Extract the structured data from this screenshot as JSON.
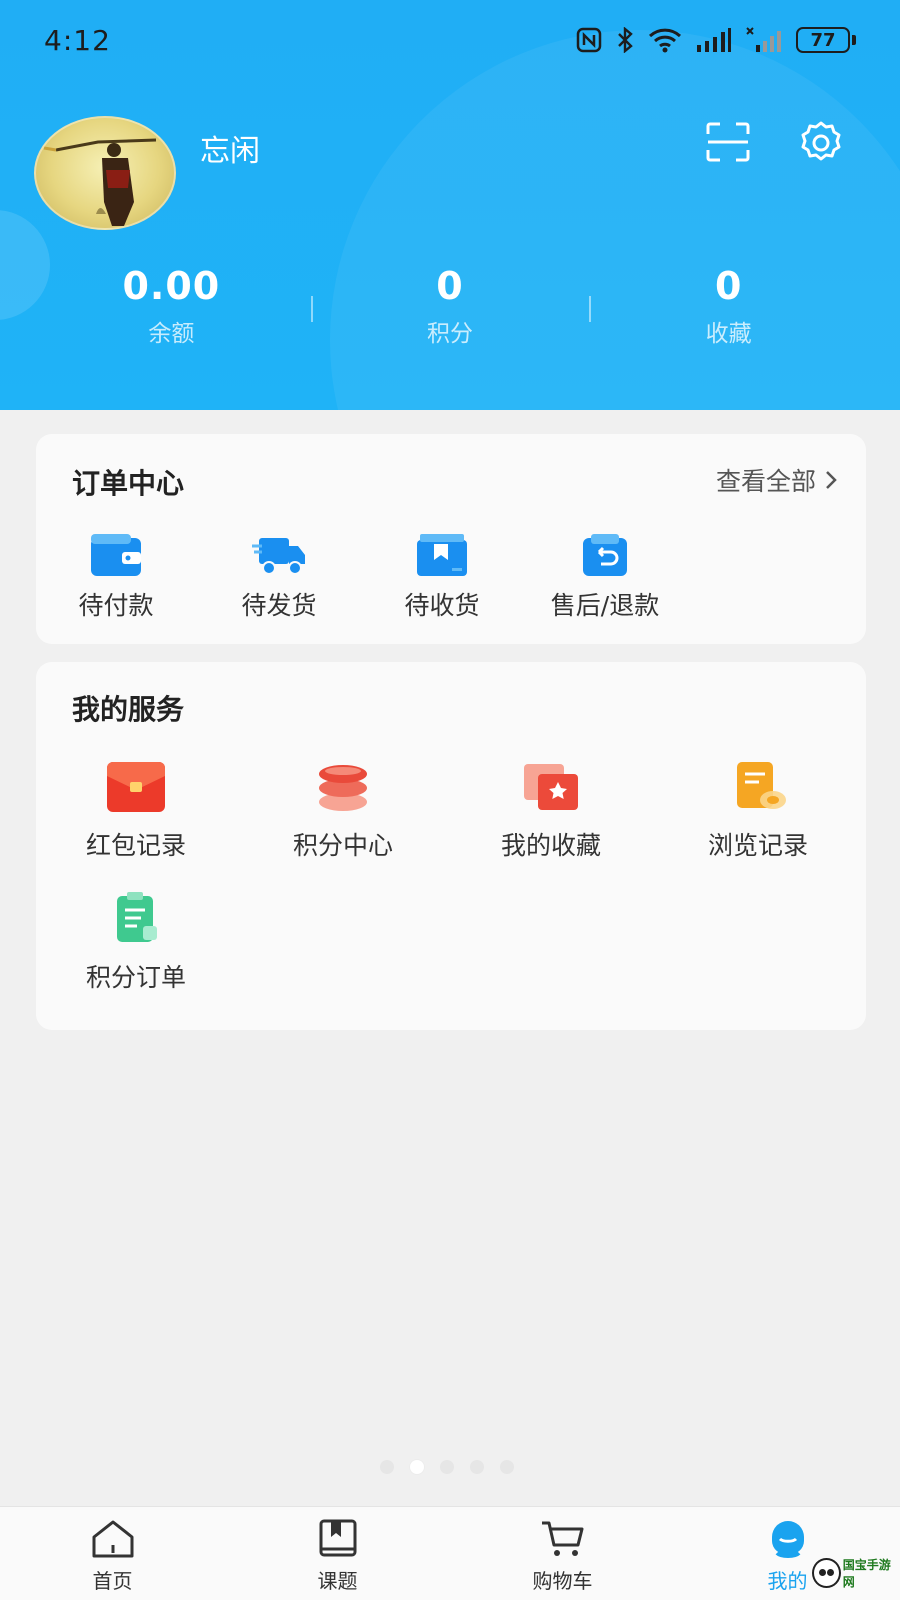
{
  "status_bar": {
    "time": "4:12",
    "battery": "77"
  },
  "profile": {
    "username": "忘闲"
  },
  "stats": [
    {
      "value": "0.00",
      "label": "余额"
    },
    {
      "value": "0",
      "label": "积分"
    },
    {
      "value": "0",
      "label": "收藏"
    }
  ],
  "orders": {
    "title": "订单中心",
    "view_all": "查看全部",
    "items": [
      {
        "label": "待付款",
        "icon": "wallet-icon"
      },
      {
        "label": "待发货",
        "icon": "truck-icon"
      },
      {
        "label": "待收货",
        "icon": "package-icon"
      },
      {
        "label": "售后/退款",
        "icon": "refund-icon"
      }
    ]
  },
  "services": {
    "title": "我的服务",
    "items": [
      {
        "label": "红包记录",
        "icon": "red-envelope-icon"
      },
      {
        "label": "积分中心",
        "icon": "coin-stack-icon"
      },
      {
        "label": "我的收藏",
        "icon": "favorite-star-icon"
      },
      {
        "label": "浏览记录",
        "icon": "history-note-icon"
      },
      {
        "label": "积分订单",
        "icon": "clipboard-icon"
      }
    ]
  },
  "tabbar": [
    {
      "label": "首页",
      "icon": "home-icon"
    },
    {
      "label": "课题",
      "icon": "book-icon"
    },
    {
      "label": "购物车",
      "icon": "cart-icon"
    },
    {
      "label": "我的",
      "icon": "profile-icon",
      "active": true
    }
  ],
  "watermark": {
    "text": "国宝手游网"
  },
  "colors": {
    "brand_blue": "#1fb0f6",
    "accent_blue": "#1aa3ef",
    "background": "#f0f0f0"
  }
}
